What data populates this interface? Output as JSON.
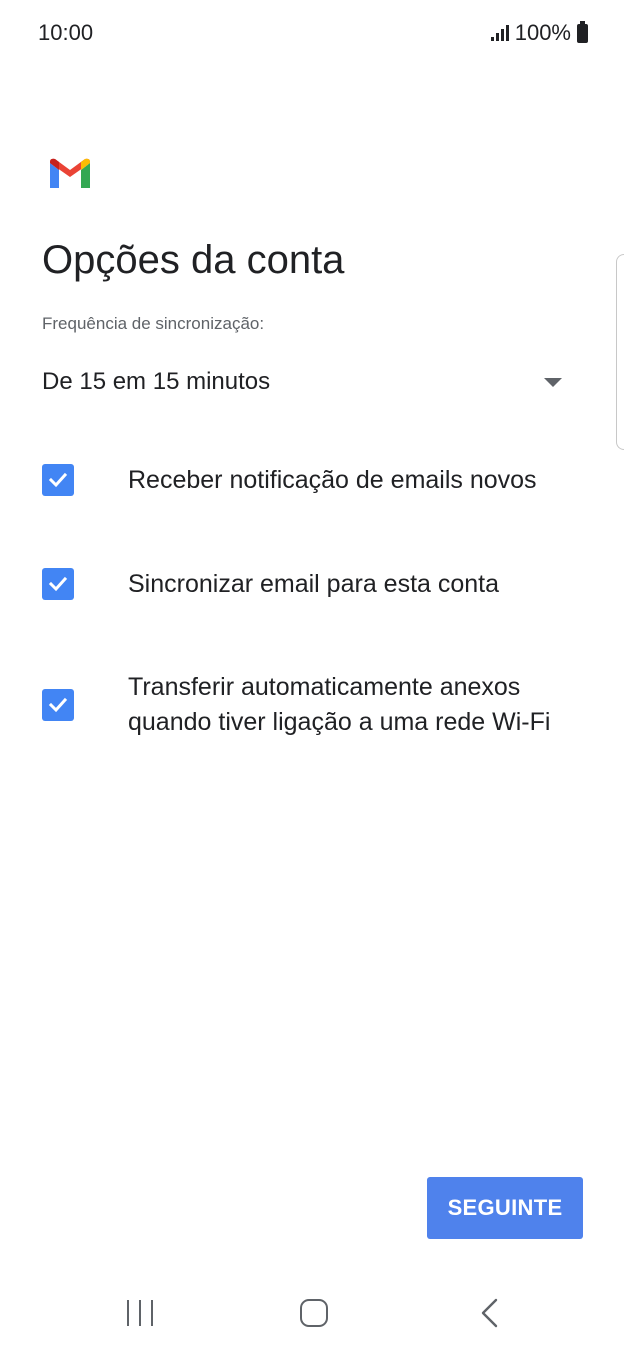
{
  "status_bar": {
    "time": "10:00",
    "battery_text": "100%",
    "icons": [
      "signal-icon",
      "battery-icon"
    ]
  },
  "app": {
    "logo": "gmail-logo",
    "brand_colors": [
      "#4285f4",
      "#ea4335",
      "#fbbc04",
      "#34a853",
      "#c5221f"
    ]
  },
  "page": {
    "title": "Opções da conta",
    "sync_frequency_label": "Frequência de sincronização:",
    "sync_frequency_value": "De 15 em 15 minutos"
  },
  "options": [
    {
      "label": "Receber notificação de emails novos",
      "checked": true
    },
    {
      "label": "Sincronizar email para esta conta",
      "checked": true
    },
    {
      "label": "Transferir automaticamente anexos quando tiver ligação a uma rede Wi-Fi",
      "checked": true
    }
  ],
  "actions": {
    "next_label": "SEGUINTE"
  },
  "nav_bar": {
    "icons": [
      "recent-apps-icon",
      "home-icon",
      "back-icon"
    ]
  },
  "colors": {
    "accent": "#4285f4",
    "button": "#4f82ec",
    "text": "#202124",
    "secondary_text": "#5f6368"
  }
}
